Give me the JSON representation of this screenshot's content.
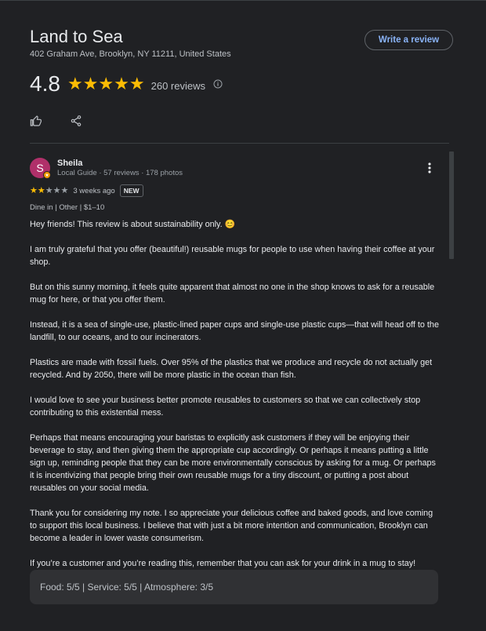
{
  "place": {
    "name": "Land to Sea",
    "address": "402 Graham Ave, Brooklyn, NY 11211, United States",
    "write_review_label": "Write a review",
    "rating": "4.8",
    "stars": 5,
    "review_count": "260 reviews"
  },
  "icons": {
    "star": "star-icon",
    "info": "info-icon",
    "like": "thumb-up-icon",
    "share": "share-icon",
    "more": "more-vert-icon"
  },
  "review": {
    "avatar_letter": "S",
    "reviewer_name": "Sheila",
    "reviewer_meta": "Local Guide · 57 reviews · 178 photos",
    "star_rating": 2,
    "time_ago": "3 weeks ago",
    "new_badge": "NEW",
    "dine_info": "Dine in  |  Other  |  $1–10",
    "paragraphs": [
      "Hey friends! This review is about sustainability only. 😊",
      "I am truly grateful that you offer (beautiful!) reusable mugs for people to use when having their coffee at your shop.",
      "But on this sunny morning, it feels quite apparent that almost no one in the shop knows to ask for a reusable mug for here, or that you offer them.",
      "Instead, it is a sea of single-use, plastic-lined paper cups and single-use plastic cups—that will head off to the landfill, to our oceans, and to our incinerators.",
      "Plastics are made with fossil fuels. Over 95% of the plastics that we produce and recycle do not actually get recycled. And by 2050, there will be more plastic in the ocean than fish.",
      "I would love to see your business better promote reusables to customers so that we can collectively stop contributing to this existential mess.",
      "Perhaps that means encouraging your baristas to explicitly ask customers if they will be enjoying their beverage to stay, and then giving them the appropriate cup accordingly. Or perhaps it means putting a little sign up, reminding people that they can be more environmentally conscious by asking for a mug. Or perhaps it is incentivizing that people bring their own reusable mugs for a tiny discount, or putting a post about reusables on your social media.",
      "Thank you for considering my note. I so appreciate your delicious coffee and baked goods, and love coming to support this local business. I believe that with just a bit more intention and communication, Brooklyn can become a leader in lower waste consumerism.",
      "If you’re a customer and you’re reading this, remember that you can ask for your drink in a mug to stay!"
    ],
    "scores": "Food: 5/5  |  Service: 5/5  |  Atmosphere: 3/5"
  },
  "colors": {
    "background": "#202124",
    "accent": "#8ab4f8",
    "star": "#fbbc04",
    "avatar": "#b0306a"
  }
}
